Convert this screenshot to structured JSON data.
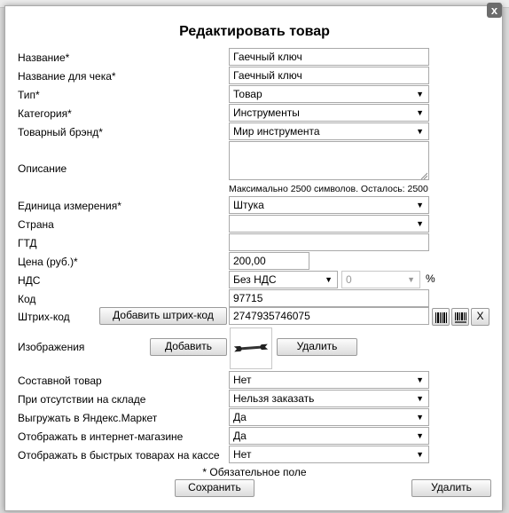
{
  "dialog": {
    "title": "Редактировать товар",
    "close_label": "x"
  },
  "fields": {
    "name": {
      "label": "Название*",
      "value": "Гаечный ключ"
    },
    "receipt_name": {
      "label": "Название для чека*",
      "value": "Гаечный ключ"
    },
    "type": {
      "label": "Тип*",
      "value": "Товар"
    },
    "category": {
      "label": "Категория*",
      "value": "Инструменты"
    },
    "brand": {
      "label": "Товарный брэнд*",
      "value": "Мир инструмента"
    },
    "description": {
      "label": "Описание",
      "value": "",
      "hint": "Максимально 2500 символов. Осталось: 2500"
    },
    "unit": {
      "label": "Единица измерения*",
      "value": "Штука"
    },
    "country": {
      "label": "Страна",
      "value": ""
    },
    "gtd": {
      "label": "ГТД",
      "value": ""
    },
    "price": {
      "label": "Цена (руб.)*",
      "value": "200,00"
    },
    "vat": {
      "label": "НДС",
      "value": "Без НДС",
      "rate": "0",
      "unit": "%"
    },
    "code": {
      "label": "Код",
      "value": "97715"
    },
    "barcode": {
      "label": "Штрих-код",
      "add_label": "Добавить штрих-код",
      "value": "2747935746075",
      "clear_label": "X"
    },
    "images": {
      "label": "Изображения",
      "add_label": "Добавить",
      "delete_label": "Удалить"
    },
    "composite": {
      "label": "Составной товар",
      "value": "Нет"
    },
    "out_of_stock": {
      "label": "При отсутствии на складе",
      "value": "Нельзя заказать"
    },
    "yandex_market": {
      "label": "Выгружать в Яндекс.Маркет",
      "value": "Да"
    },
    "show_in_shop": {
      "label": "Отображать в интернет-магазине",
      "value": "Да"
    },
    "quick_checkout": {
      "label": "Отображать в быстрых товарах на кассе",
      "value": "Нет"
    }
  },
  "footer": {
    "required_note": "* Обязательное поле",
    "save_label": "Сохранить",
    "delete_label": "Удалить"
  },
  "icons": {
    "barcode_1": "barcode-icon",
    "barcode_2": "barcode-print-icon",
    "thumbnail": "wrench-icon",
    "textarea_grip": "resize-grip-icon"
  }
}
